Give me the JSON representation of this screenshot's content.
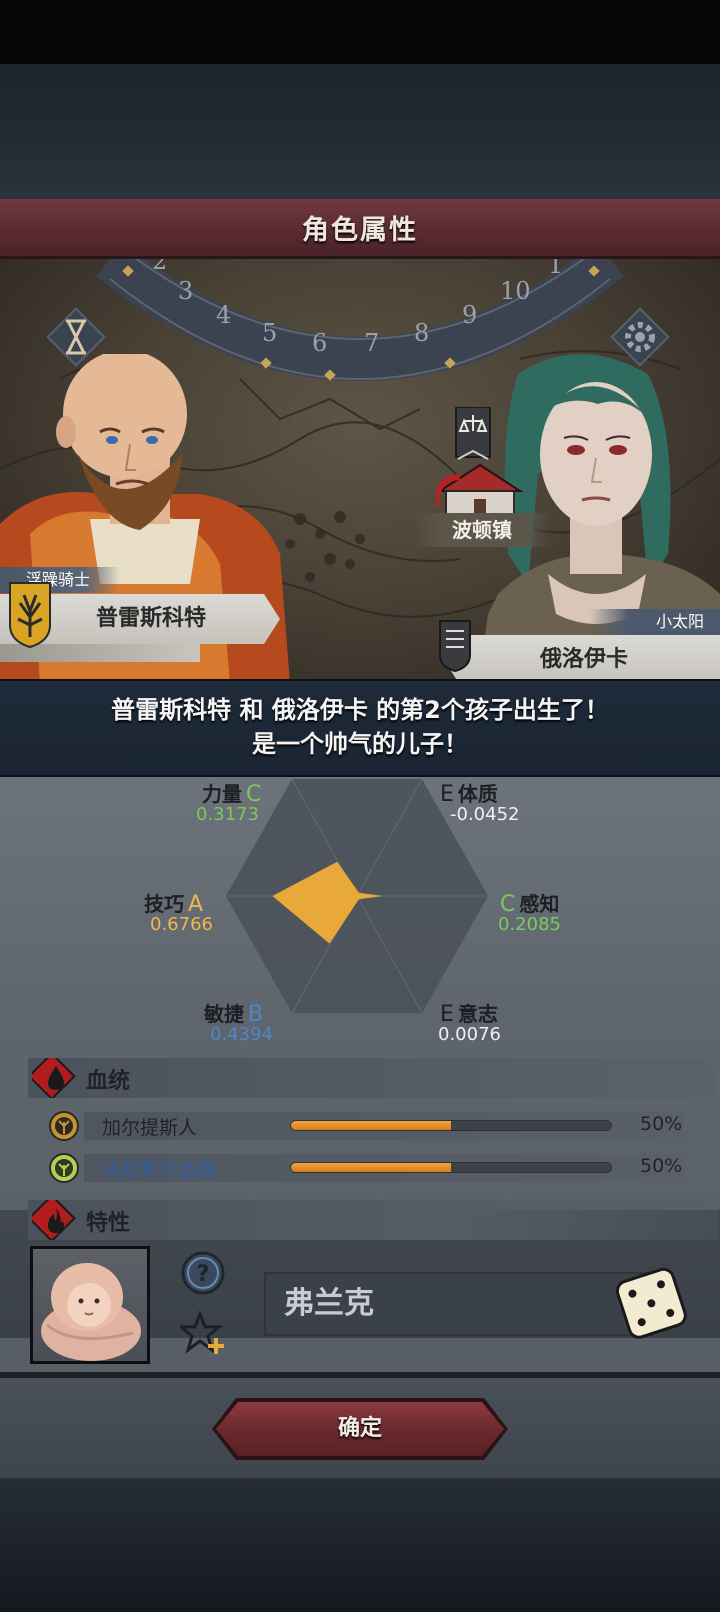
{
  "window": {
    "title": "角色属性"
  },
  "scene": {
    "calendar_numbers": [
      "2",
      "3",
      "4",
      "5",
      "6",
      "7",
      "8",
      "9",
      "10",
      "1"
    ],
    "town": "波顿镇",
    "father": {
      "role": "浮躁骑士",
      "name": "普雷斯科特"
    },
    "mother": {
      "role": "小太阳",
      "name": "俄洛伊卡"
    }
  },
  "announcement": {
    "line1": "普雷斯科特 和 俄洛伊卡 的第2个孩子出生了！",
    "line2": "是一个帅气的儿子！"
  },
  "stats": {
    "strength": {
      "label": "力量",
      "grade": "C",
      "value": "0.3173"
    },
    "constitution": {
      "label": "体质",
      "grade": "E",
      "value": "-0.0452"
    },
    "skill": {
      "label": "技巧",
      "grade": "A",
      "value": "0.6766"
    },
    "perception": {
      "label": "感知",
      "grade": "C",
      "value": "0.2085"
    },
    "agility": {
      "label": "敏捷",
      "grade": "B",
      "value": "0.4394"
    },
    "will": {
      "label": "意志",
      "grade": "E",
      "value": "0.0076"
    }
  },
  "colors": {
    "grade_A": "#f0b84a",
    "grade_B": "#4f86c8",
    "grade_C": "#7cc95a",
    "grade_E": "#1c1f24",
    "radar_fill": "#e8a93a",
    "lineage_1_name": "#1f2329",
    "lineage_2_name": "#2e5f9e"
  },
  "lineage": {
    "title": "血统",
    "items": [
      {
        "name": "加尔提斯人",
        "percent": "50%",
        "fraction": 0.5,
        "icon": "tree-emblem-icon"
      },
      {
        "name": "法拉希尔血裔",
        "percent": "50%",
        "fraction": 0.5,
        "icon": "leaf-tree-icon"
      }
    ]
  },
  "traits": {
    "title": "特性"
  },
  "child": {
    "name": "弗兰克"
  },
  "confirm_label": "确定"
}
